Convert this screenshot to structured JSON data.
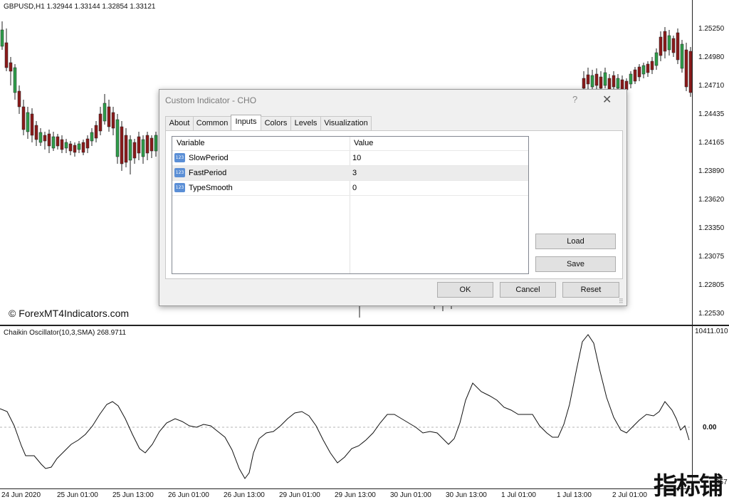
{
  "header": {
    "symbol_info": "GBPUSD,H1  1.32944 1.33144 1.32854 1.33121"
  },
  "price_axis": [
    "1.25250",
    "1.24980",
    "1.24710",
    "1.24435",
    "1.24165",
    "1.23890",
    "1.23620",
    "1.23350",
    "1.23075",
    "1.22805",
    "1.22530"
  ],
  "watermark": "© ForexMT4Indicators.com",
  "indicator": {
    "label": "Chaikin Oscillator(10,3,SMA) 268.9711",
    "axis_top": "10411.010",
    "axis_zero": "0.00",
    "axis_bottom": "957"
  },
  "time_axis": [
    "24 Jun 2020",
    "25 Jun 01:00",
    "25 Jun 13:00",
    "26 Jun 01:00",
    "26 Jun 13:00",
    "29 Jun 01:00",
    "29 Jun 13:00",
    "30 Jun 01:00",
    "30 Jun 13:00",
    "1 Jul 01:00",
    "1 Jul 13:00",
    "2 Jul 01:00"
  ],
  "dialog": {
    "title": "Custom Indicator - CHO",
    "help": "?",
    "close": "✕",
    "tabs": [
      "About",
      "Common",
      "Inputs",
      "Colors",
      "Levels",
      "Visualization"
    ],
    "active_tab": "Inputs",
    "columns": [
      "Variable",
      "Value"
    ],
    "rows": [
      {
        "variable": "SlowPeriod",
        "value": "10"
      },
      {
        "variable": "FastPeriod",
        "value": "3"
      },
      {
        "variable": "TypeSmooth",
        "value": "0"
      }
    ],
    "row_icon": "123",
    "load_label": "Load",
    "save_label": "Save",
    "ok_label": "OK",
    "cancel_label": "Cancel",
    "reset_label": "Reset"
  },
  "corner_mark": "指标铺",
  "colors": {
    "bull": "#2e9d4a",
    "bear": "#8b1a1a",
    "line": "#111111"
  }
}
